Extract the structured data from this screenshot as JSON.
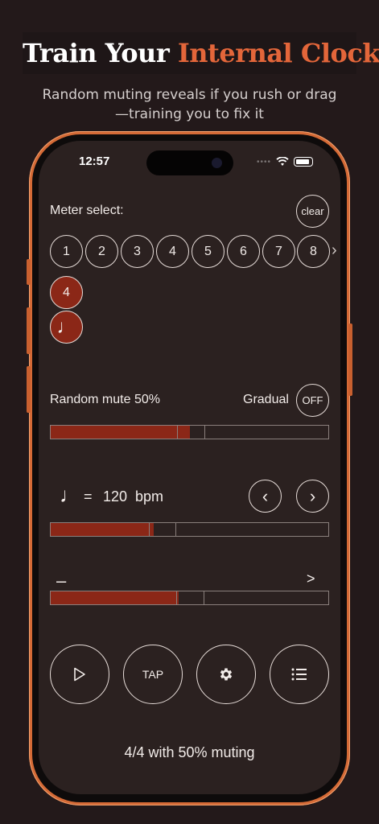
{
  "headline": {
    "part1": "Train Your ",
    "part2": "Internal Clock"
  },
  "subtitle": {
    "line1": "Random muting reveals if you rush or drag",
    "line2": "—training you to fix it"
  },
  "status_bar": {
    "time": "12:57"
  },
  "meter": {
    "label": "Meter select:",
    "clear_label": "clear",
    "beats": [
      "1",
      "2",
      "3",
      "4",
      "5",
      "6",
      "7",
      "8"
    ],
    "more_glyph": "›",
    "selected_beats": "4",
    "selected_note": "♩"
  },
  "mute": {
    "label": "Random mute 50%",
    "gradual_label": "Gradual",
    "gradual_state": "OFF",
    "level": 0.5
  },
  "tempo": {
    "note_glyph": "♩",
    "equals": "=",
    "bpm": "120",
    "unit": "bpm",
    "prev_glyph": "‹",
    "next_glyph": "›",
    "level": 0.37
  },
  "accent": {
    "left_glyph": "–",
    "right_glyph": ">",
    "level": 0.46
  },
  "controls": {
    "tap_label": "TAP"
  },
  "summary": "4/4 with 50% muting",
  "colors": {
    "accent": "#e3663a",
    "fill": "#8b2717",
    "phone": "#d46a36",
    "screen": "#2b2120"
  }
}
